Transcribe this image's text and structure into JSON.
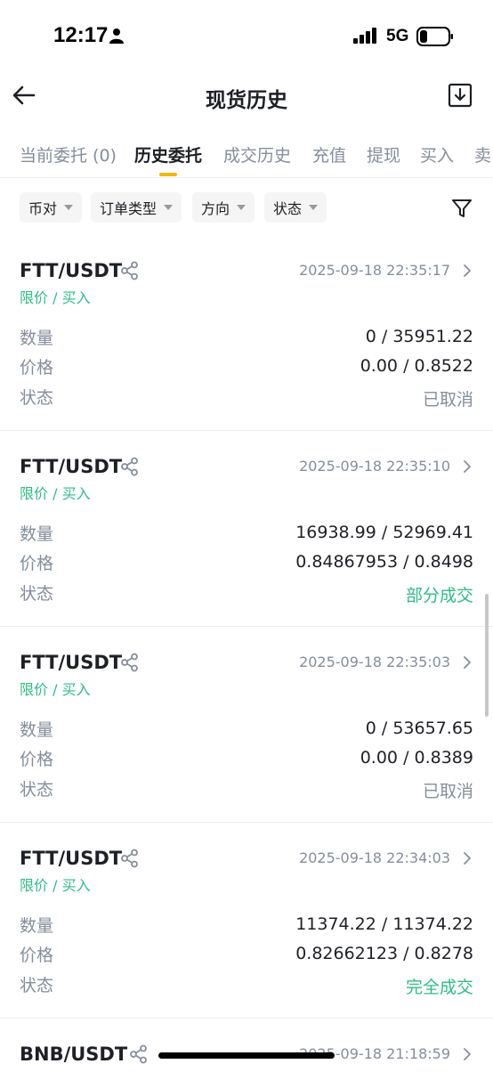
{
  "status_bar": {
    "time": "12:17",
    "network": "5G"
  },
  "header": {
    "title": "现货历史"
  },
  "tabs": [
    {
      "label": "当前委托 (0)"
    },
    {
      "label": "历史委托"
    },
    {
      "label": "成交历史"
    },
    {
      "label": "充值"
    },
    {
      "label": "提现"
    },
    {
      "label": "买入"
    },
    {
      "label": "卖"
    }
  ],
  "filters": [
    {
      "label": "币对"
    },
    {
      "label": "订单类型"
    },
    {
      "label": "方向"
    },
    {
      "label": "状态"
    }
  ],
  "labels": {
    "quantity": "数量",
    "price": "价格",
    "status": "状态"
  },
  "orders": [
    {
      "pair": "FTT/USDT",
      "time": "2025-09-18 22:35:17",
      "type": "限价 / 买入",
      "quantity": "0 / 35951.22",
      "price": "0.00 / 0.8522",
      "status": "已取消"
    },
    {
      "pair": "FTT/USDT",
      "time": "2025-09-18 22:35:10",
      "type": "限价 / 买入",
      "quantity": "16938.99 / 52969.41",
      "price": "0.84867953 / 0.8498",
      "status": "部分成交"
    },
    {
      "pair": "FTT/USDT",
      "time": "2025-09-18 22:35:03",
      "type": "限价 / 买入",
      "quantity": "0 / 53657.65",
      "price": "0.00 / 0.8389",
      "status": "已取消"
    },
    {
      "pair": "FTT/USDT",
      "time": "2025-09-18 22:34:03",
      "type": "限价 / 买入",
      "quantity": "11374.22 / 11374.22",
      "price": "0.82662123 / 0.8278",
      "status": "完全成交"
    },
    {
      "pair": "BNB/USDT",
      "time": "2025-09-18 21:18:59"
    }
  ],
  "colors": {
    "accent": "#f0b90b",
    "buy": "#2ebd85",
    "muted": "#848e9c",
    "text": "#1e2026"
  }
}
